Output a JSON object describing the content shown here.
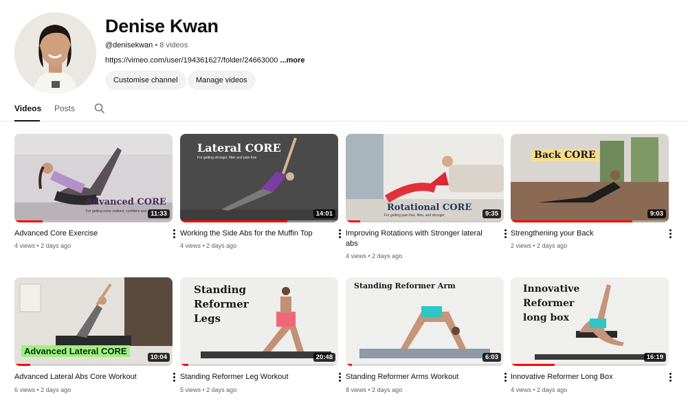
{
  "channel": {
    "name": "Denise Kwan",
    "handle": "@denisekwan",
    "video_count": " • 8 videos",
    "link": "https://vimeo.com/user/194361627/folder/24663000",
    "link_more": " ...more",
    "buttons": {
      "customise": "Customise channel",
      "manage": "Manage videos"
    }
  },
  "tabs": [
    {
      "label": "Videos",
      "active": true
    },
    {
      "label": "Posts",
      "active": false
    }
  ],
  "colors": {
    "accent": "#ff0000",
    "text": "#0f0f0f",
    "secondary": "#606060",
    "chip": "#f2f2f2"
  },
  "videos": [
    {
      "title": "Advanced Core Exercise",
      "stats": "4 views • 2 days ago",
      "duration": "11:33",
      "progress": 0.18,
      "overlay": "Advanced CORE",
      "overlay_sub": "For getting more resilient, confident and..."
    },
    {
      "title": "Working the Side Abs for the Muffin Top",
      "stats": "4 views • 2 days ago",
      "duration": "14:01",
      "progress": 0.68,
      "overlay": "Lateral CORE",
      "overlay_sub": "For getting stronger, fitter and pain free"
    },
    {
      "title": "Improving Rotations with Stronger lateral abs",
      "stats": "4 views • 2 days ago",
      "duration": "9:35",
      "progress": 0.09,
      "overlay": "Rotational CORE",
      "overlay_sub": "For getting pain free, fitter, and stronger"
    },
    {
      "title": "Strengthening your Back",
      "stats": "2 views • 2 days ago",
      "duration": "9:03",
      "progress": 0.77,
      "overlay": "Back CORE",
      "overlay_sub": ""
    },
    {
      "title": "Advanced Lateral Abs Core Workout",
      "stats": "6 views • 2 days ago",
      "duration": "10:04",
      "progress": 0.1,
      "overlay": "Advanced Lateral CORE",
      "overlay_sub": ""
    },
    {
      "title": "Standing Reformer Leg Workout",
      "stats": "5 views • 2 days ago",
      "duration": "20:48",
      "progress": 0.05,
      "overlay": "Standing Reformer Legs",
      "overlay_sub": ""
    },
    {
      "title": "Standing Reformer Arms Workout",
      "stats": "8 views • 2 days ago",
      "duration": "6:03",
      "progress": 0.04,
      "overlay": "Standing Reformer Arm",
      "overlay_sub": ""
    },
    {
      "title": "Innovative Reformer Long Box",
      "stats": "4 views • 2 days ago",
      "duration": "16:19",
      "progress": 0.28,
      "overlay": "Innovative Reformer long box",
      "overlay_sub": ""
    }
  ]
}
